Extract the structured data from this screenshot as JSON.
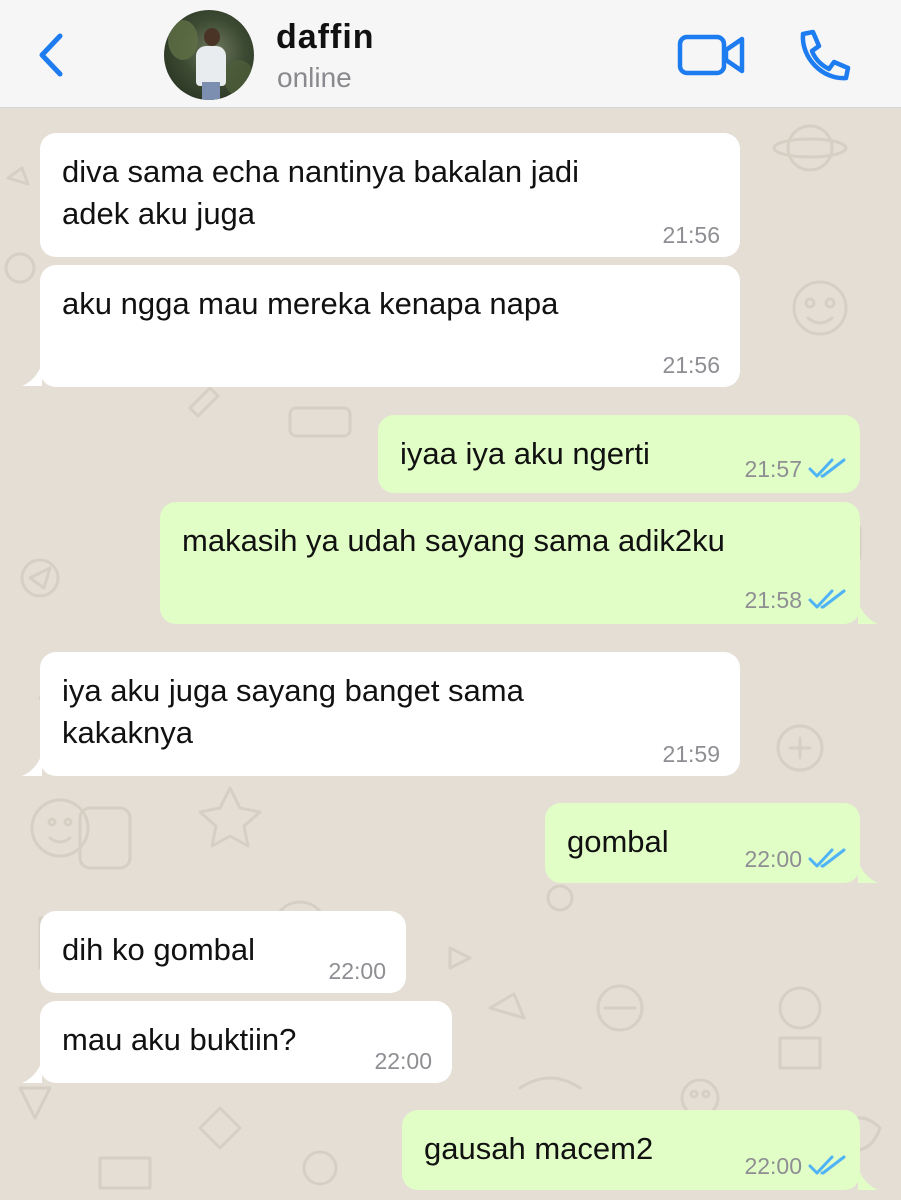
{
  "header": {
    "contact_name": "daffin",
    "status": "online"
  },
  "colors": {
    "accent": "#1e7cf1",
    "incoming_bubble": "#ffffff",
    "outgoing_bubble": "#e1fec6",
    "read_ticks": "#4fb3f6",
    "chat_background": "#e4ded5"
  },
  "messages": [
    {
      "direction": "in",
      "text": "diva sama echa nantinya bakalan jadi\nadek aku juga",
      "time": "21:56"
    },
    {
      "direction": "in",
      "text": "aku ngga mau mereka kenapa napa",
      "time": "21:56"
    },
    {
      "direction": "out",
      "text": "iyaa iya aku ngerti",
      "time": "21:57",
      "status": "read"
    },
    {
      "direction": "out",
      "text": "makasih ya udah sayang sama adik2ku",
      "time": "21:58",
      "status": "read"
    },
    {
      "direction": "in",
      "text": "iya aku juga sayang banget sama\nkakaknya",
      "time": "21:59"
    },
    {
      "direction": "out",
      "text": "gombal",
      "time": "22:00",
      "status": "read"
    },
    {
      "direction": "in",
      "text": "dih ko gombal",
      "time": "22:00"
    },
    {
      "direction": "in",
      "text": "mau aku buktiin?",
      "time": "22:00"
    },
    {
      "direction": "out",
      "text": "gausah macem2",
      "time": "22:00",
      "status": "read"
    }
  ]
}
